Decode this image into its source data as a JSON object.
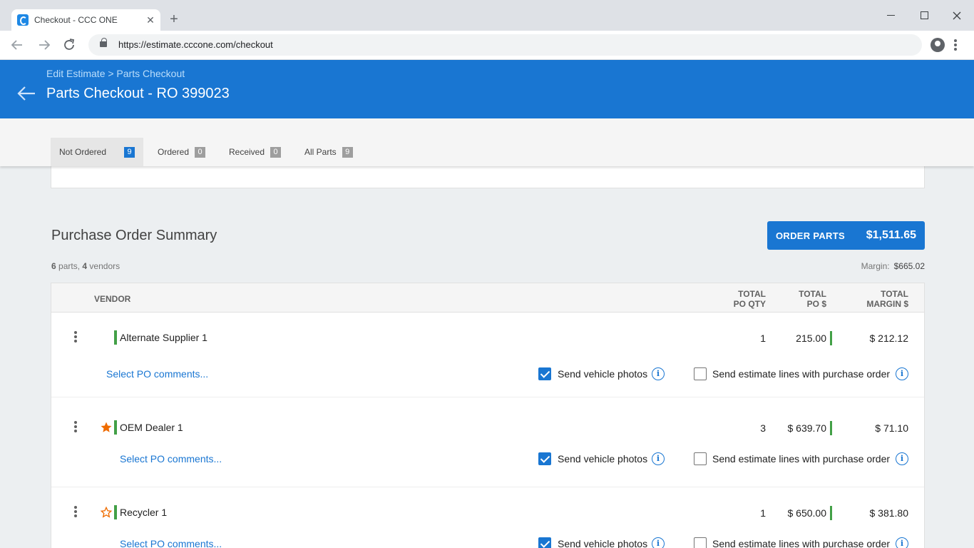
{
  "browser": {
    "tab_title": "Checkout - CCC ONE",
    "tab_close": "✕",
    "new_tab": "+",
    "url": "https://estimate.cccone.com/checkout"
  },
  "header": {
    "breadcrumb": "Edit Estimate > Parts Checkout",
    "title": "Parts Checkout - RO 399023"
  },
  "tabs": [
    {
      "label": "Not Ordered",
      "count": "9",
      "active": true
    },
    {
      "label": "Ordered",
      "count": "0"
    },
    {
      "label": "Received",
      "count": "0"
    },
    {
      "label": "All Parts",
      "count": "9"
    }
  ],
  "summary": {
    "title": "Purchase Order Summary",
    "parts_count": "6",
    "parts_word": "parts,",
    "vendors_count": "4",
    "vendors_word": "vendors",
    "margin_label": "Margin:",
    "margin_value": "$665.02",
    "order_button_label": "ORDER PARTS",
    "order_button_amount": "$1,511.65"
  },
  "table": {
    "headers": {
      "vendor": "VENDOR",
      "qty_line1": "TOTAL",
      "qty_line2": "PO QTY",
      "po_line1": "TOTAL",
      "po_line2": "PO $",
      "margin_line1": "TOTAL",
      "margin_line2": "MARGIN $"
    },
    "rows": [
      {
        "vendor": "Alternate Supplier 1",
        "star": "none",
        "qty": "1",
        "po": "215.00",
        "margin": "$ 212.12",
        "comments": "Select PO comments...",
        "photos_label": "Send vehicle photos",
        "photos_checked": true,
        "lines_label": "Send estimate lines with purchase order",
        "lines_checked": false
      },
      {
        "vendor": "OEM Dealer 1",
        "star": "filled",
        "qty": "3",
        "po": "$ 639.70",
        "margin": "$ 71.10",
        "comments": "Select PO comments...",
        "photos_label": "Send vehicle photos",
        "photos_checked": true,
        "lines_label": "Send estimate lines with purchase order",
        "lines_checked": false
      },
      {
        "vendor": "Recycler 1",
        "star": "outline",
        "qty": "1",
        "po": "$ 650.00",
        "margin": "$ 381.80",
        "comments": "Select PO comments...",
        "photos_label": "Send vehicle photos",
        "photos_checked": true,
        "lines_label": "Send estimate lines with purchase order",
        "lines_checked": false
      }
    ]
  },
  "icons": {
    "info": "i"
  },
  "colors": {
    "primary": "#1976d2",
    "vendor_bar": "#43a047",
    "star": "#ef6c00"
  }
}
